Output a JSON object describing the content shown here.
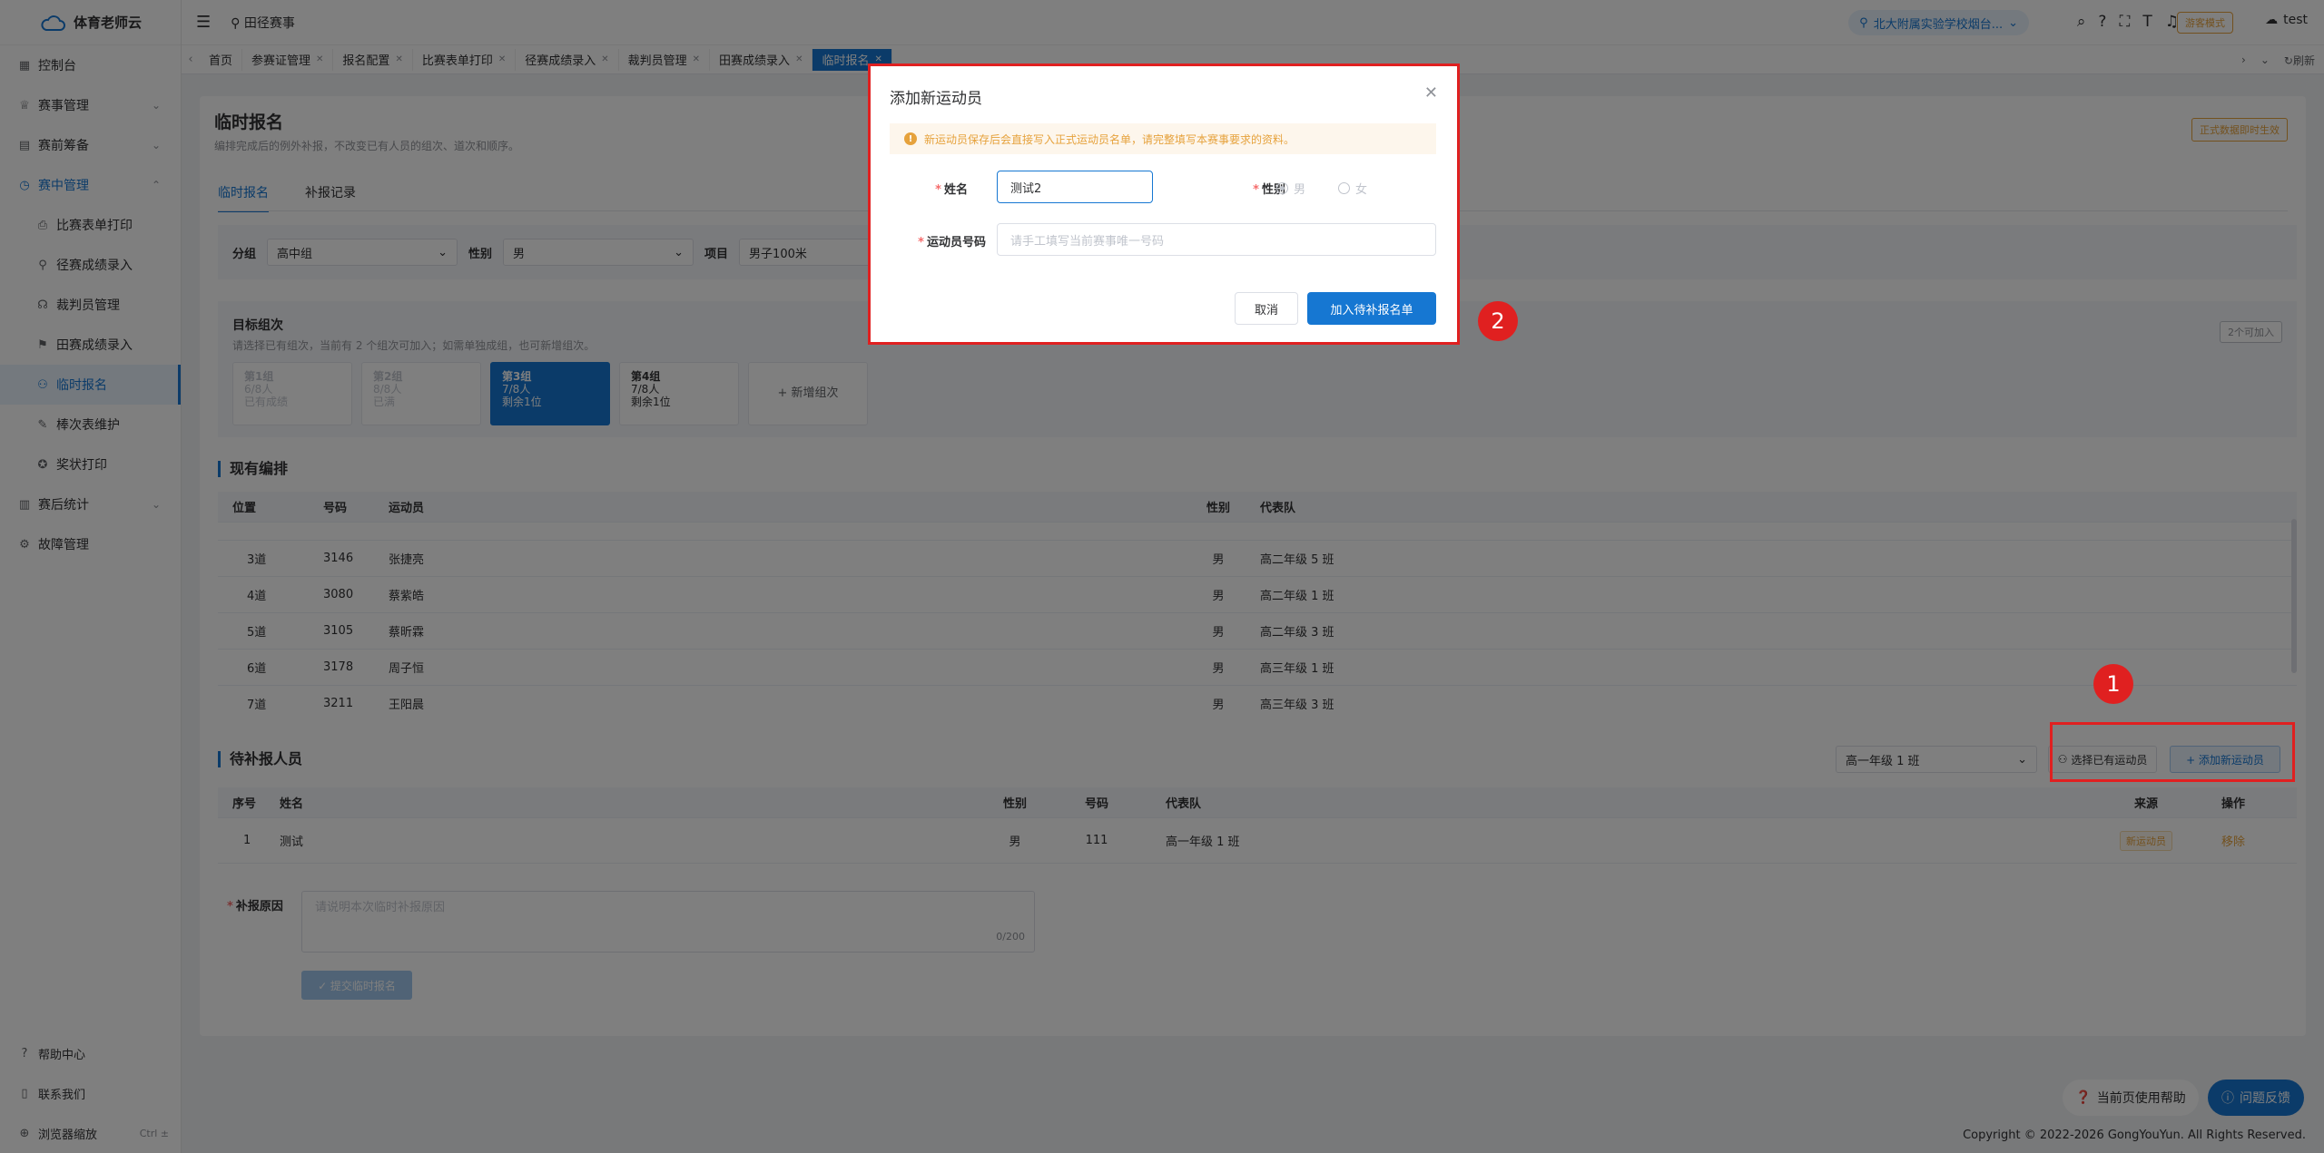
{
  "app": {
    "name": "体育老师云"
  },
  "sidebar": {
    "items": [
      {
        "label": "控制台"
      },
      {
        "label": "赛事管理"
      },
      {
        "label": "赛前筹备"
      },
      {
        "label": "赛中管理"
      }
    ],
    "sub_items": [
      {
        "label": "比赛表单打印"
      },
      {
        "label": "径赛成绩录入"
      },
      {
        "label": "裁判员管理"
      },
      {
        "label": "田赛成绩录入"
      },
      {
        "label": "临时报名"
      },
      {
        "label": "棒次表维护"
      },
      {
        "label": "奖状打印"
      }
    ],
    "after_items": [
      {
        "label": "赛后统计"
      },
      {
        "label": "故障管理"
      }
    ],
    "bottom": [
      {
        "label": "帮助中心"
      },
      {
        "label": "联系我们"
      },
      {
        "label": "浏览器缩放",
        "hint": "Ctrl ±"
      }
    ]
  },
  "header": {
    "breadcrumb": "田径赛事",
    "school": "北大附属实验学校烟台...",
    "visitor": "游客模式",
    "user": "test"
  },
  "tabs": [
    {
      "label": "首页"
    },
    {
      "label": "参赛证管理"
    },
    {
      "label": "报名配置"
    },
    {
      "label": "比赛表单打印"
    },
    {
      "label": "径赛成绩录入"
    },
    {
      "label": "裁判员管理"
    },
    {
      "label": "田赛成绩录入"
    },
    {
      "label": "临时报名"
    }
  ],
  "tabs_right": {
    "refresh": "刷新"
  },
  "page": {
    "title": "临时报名",
    "desc": "编排完成后的例外补报，不改变已有人员的组次、道次和顺序。",
    "status_tag": "正式数据即时生效",
    "inner_tabs": [
      {
        "label": "临时报名"
      },
      {
        "label": "补报记录"
      }
    ]
  },
  "filters": {
    "group_label": "分组",
    "group_value": "高中组",
    "gender_label": "性别",
    "gender_value": "男",
    "event_label": "项目",
    "event_value": "男子100米"
  },
  "target_group": {
    "title": "目标组次",
    "desc": "请选择已有组次，当前有 2 个组次可加入；如需单独成组，也可新增组次。",
    "available": "2个可加入",
    "cards": [
      {
        "name": "第1组",
        "count": "6/8人",
        "status": "已有成绩"
      },
      {
        "name": "第2组",
        "count": "8/8人",
        "status": "已满"
      },
      {
        "name": "第3组",
        "count": "7/8人",
        "status": "剩余1位"
      },
      {
        "name": "第4组",
        "count": "7/8人",
        "status": "剩余1位"
      }
    ],
    "add_label": "+ 新增组次"
  },
  "current": {
    "title": "现有编排",
    "headers": [
      "位置",
      "号码",
      "运动员",
      "性别",
      "代表队"
    ],
    "rows": [
      {
        "pos": "3道",
        "num": "3146",
        "name": "张捷亮",
        "gender": "男",
        "team": "高二年级 5 班"
      },
      {
        "pos": "4道",
        "num": "3080",
        "name": "蔡紫皓",
        "gender": "男",
        "team": "高二年级 1 班"
      },
      {
        "pos": "5道",
        "num": "3105",
        "name": "蔡昕霖",
        "gender": "男",
        "team": "高二年级 3 班"
      },
      {
        "pos": "6道",
        "num": "3178",
        "name": "周子恒",
        "gender": "男",
        "team": "高三年级 1 班"
      },
      {
        "pos": "7道",
        "num": "3211",
        "name": "王阳晨",
        "gender": "男",
        "team": "高三年级 3 班"
      }
    ]
  },
  "pending": {
    "title": "待补报人员",
    "class_select": "高一年级 1 班",
    "choose_btn": "选择已有运动员",
    "add_btn": "+ 添加新运动员",
    "headers": [
      "序号",
      "姓名",
      "性别",
      "号码",
      "代表队",
      "来源",
      "操作"
    ],
    "rows": [
      {
        "idx": "1",
        "name": "测试",
        "gender": "男",
        "num": "111",
        "team": "高一年级 1 班",
        "source": "新运动员",
        "action": "移除"
      }
    ]
  },
  "reason": {
    "label": "补报原因",
    "placeholder": "请说明本次临时补报原因",
    "count": "0/200",
    "submit": "✓ 提交临时报名"
  },
  "dialog": {
    "title": "添加新运动员",
    "alert": "新运动员保存后会直接写入正式运动员名单，请完整填写本赛事要求的资料。",
    "name_label": "姓名",
    "name_value": "测试2",
    "gender_label": "性别",
    "male": "男",
    "female": "女",
    "number_label": "运动员号码",
    "number_placeholder": "请手工填写当前赛事唯一号码",
    "cancel": "取消",
    "confirm": "加入待补报名单"
  },
  "annotations": {
    "badge1": "1",
    "badge2": "2"
  },
  "float": {
    "help": "当前页使用帮助",
    "feedback": "问题反馈"
  },
  "footer": {
    "copyright": "Copyright © 2022-2026 GongYouYun. All Rights Reserved."
  },
  "colors": {
    "primary": "#1677d2",
    "warning": "#e6a23c",
    "annotation": "#e02020"
  }
}
